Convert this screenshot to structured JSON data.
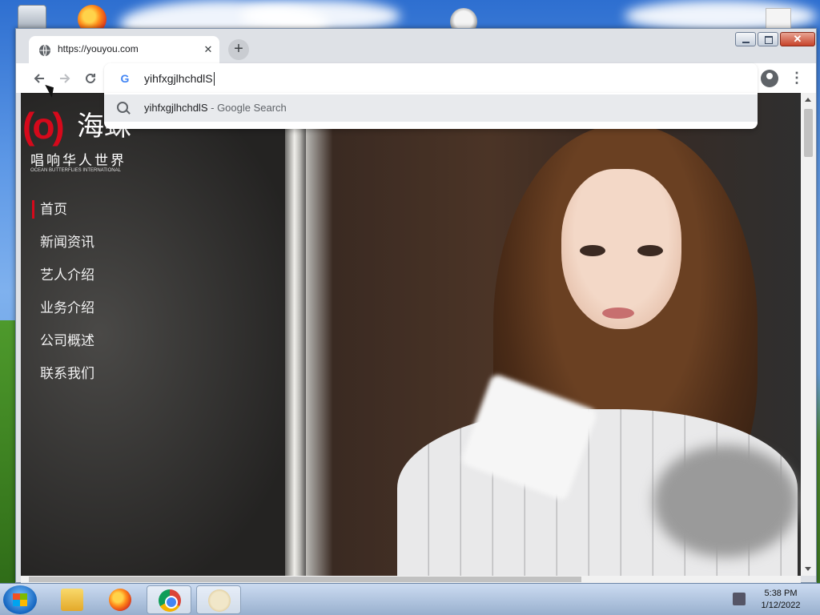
{
  "browser": {
    "tab_title": "https://youyou.com",
    "new_tab_icon": "plus-icon",
    "close_icon": "close-icon",
    "window_close_glyph": "✕",
    "omnibox_value": "yihfxgjlhchdlS",
    "suggestion": {
      "query": "yihfxgjlhchdlS",
      "separator": " - ",
      "engine": "Google Search"
    }
  },
  "site": {
    "logo_mark": "(o)",
    "logo_name": "海蛛",
    "logo_slogan": "唱响华人世界",
    "logo_en": "OCEAN BUTTERFLIES INTERNATIONAL",
    "nav": [
      {
        "label": "首页",
        "active": true
      },
      {
        "label": "新闻资讯"
      },
      {
        "label": "艺人介绍"
      },
      {
        "label": "业务介绍"
      },
      {
        "label": "公司概述"
      },
      {
        "label": "联系我们"
      }
    ]
  },
  "taskbar": {
    "time": "5:38 PM",
    "date": "1/12/2022"
  },
  "colors": {
    "accent": "#d6091b",
    "chrome_frame": "#dee1e6"
  }
}
